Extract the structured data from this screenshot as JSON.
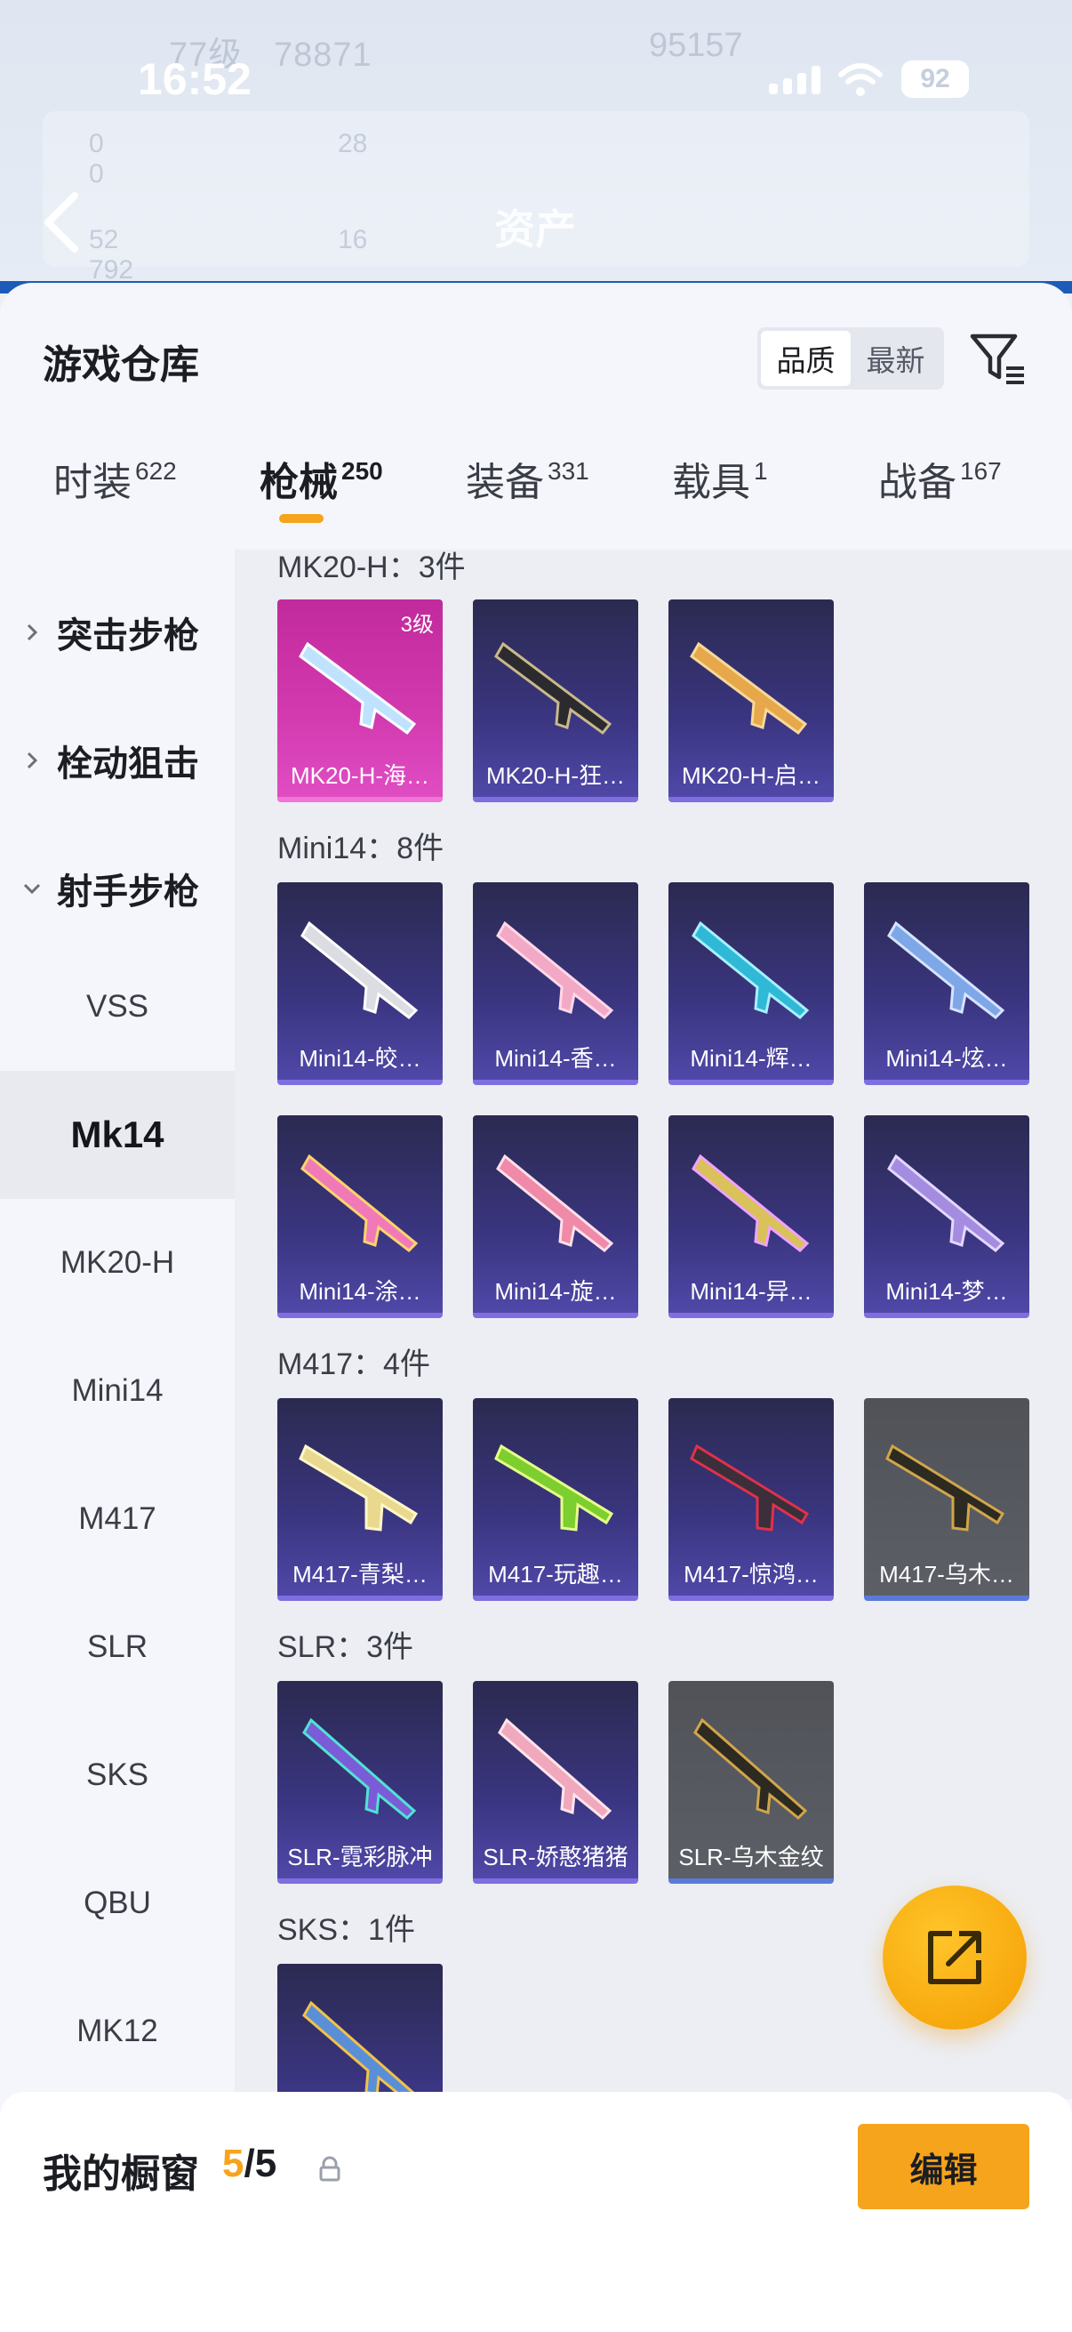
{
  "status_bar": {
    "time": "16:52",
    "battery": "92"
  },
  "header": {
    "title": "资产",
    "ghost_level": "77级",
    "ghost_points": "78871",
    "ghost_right": "95157",
    "ghost_stats": [
      "0",
      "28",
      "0",
      "52",
      "16",
      "792"
    ]
  },
  "sheet": {
    "title": "游戏仓库",
    "sort_options": [
      "品质",
      "最新"
    ],
    "tabs": [
      {
        "label": "时装",
        "count": "622"
      },
      {
        "label": "枪械",
        "count": "250"
      },
      {
        "label": "装备",
        "count": "331"
      },
      {
        "label": "载具",
        "count": "1"
      },
      {
        "label": "战备",
        "count": "167"
      }
    ],
    "active_tab": "枪械"
  },
  "sidebar": {
    "categories": [
      "突击步枪",
      "栓动狙击",
      "射手步枪"
    ],
    "subitems": [
      "VSS",
      "Mk14",
      "MK20-H",
      "Mini14",
      "M417",
      "SLR",
      "SKS",
      "QBU",
      "MK12"
    ],
    "active_sub": "Mk14"
  },
  "groups": [
    {
      "title": "MK20-H：3件",
      "items": [
        {
          "label": "MK20-H-海…",
          "rarity": "pink",
          "level": "3级"
        },
        {
          "label": "MK20-H-狂…",
          "rarity": "purple"
        },
        {
          "label": "MK20-H-启…",
          "rarity": "purple"
        }
      ]
    },
    {
      "title": "Mini14：8件",
      "items": [
        {
          "label": "Mini14-皎…",
          "rarity": "purple"
        },
        {
          "label": "Mini14-香…",
          "rarity": "purple"
        },
        {
          "label": "Mini14-辉…",
          "rarity": "purple"
        },
        {
          "label": "Mini14-炫…",
          "rarity": "purple"
        },
        {
          "label": "Mini14-涂…",
          "rarity": "purple"
        },
        {
          "label": "Mini14-旋…",
          "rarity": "purple"
        },
        {
          "label": "Mini14-异…",
          "rarity": "purple"
        },
        {
          "label": "Mini14-梦…",
          "rarity": "purple"
        }
      ]
    },
    {
      "title": "M417：4件",
      "items": [
        {
          "label": "M417-青梨…",
          "rarity": "purple"
        },
        {
          "label": "M417-玩趣…",
          "rarity": "purple"
        },
        {
          "label": "M417-惊鸿…",
          "rarity": "purple"
        },
        {
          "label": "M417-乌木…",
          "rarity": "gray"
        }
      ]
    },
    {
      "title": "SLR：3件",
      "items": [
        {
          "label": "SLR-霓彩脉冲",
          "rarity": "purple"
        },
        {
          "label": "SLR-娇憨猪猪",
          "rarity": "purple"
        },
        {
          "label": "SLR-乌木金纹",
          "rarity": "gray"
        }
      ]
    },
    {
      "title": "SKS：1件",
      "items": [
        {
          "label": "",
          "rarity": "purple"
        }
      ]
    }
  ],
  "bottom_bar": {
    "title": "我的橱窗",
    "current": "5",
    "total": "/5",
    "edit_label": "编辑"
  },
  "colors": {
    "accent": "#f5a41c",
    "purple_card": "#3a3580",
    "pink_card": "#d33ab0",
    "gray_card": "#5c5f66"
  }
}
